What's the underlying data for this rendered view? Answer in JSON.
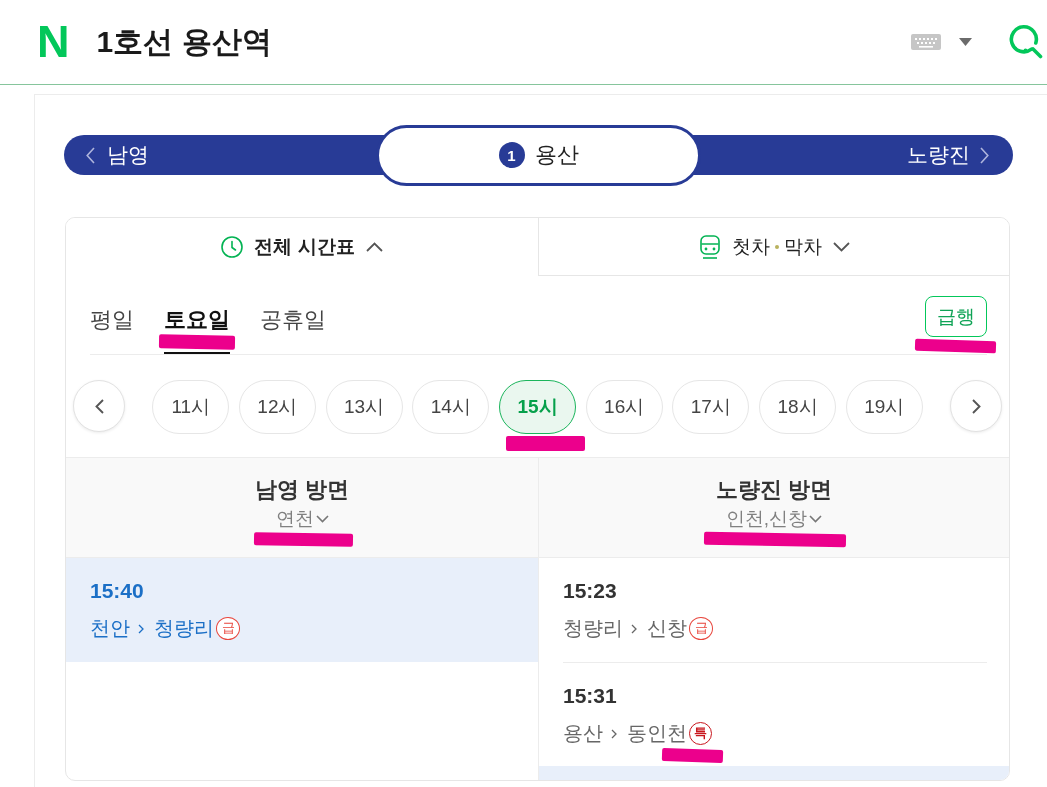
{
  "header": {
    "logo": "N",
    "title": "1호선 용산역"
  },
  "station_nav": {
    "prev": "남영",
    "current": {
      "line": "1",
      "name": "용산"
    },
    "next": "노량진"
  },
  "view_tabs": [
    {
      "kind": "full",
      "label_parts": [
        "전체 시간표"
      ],
      "selected": true,
      "expanded": true
    },
    {
      "kind": "first_last",
      "label_parts": [
        "첫차",
        "막차"
      ],
      "selected": false,
      "expanded": false
    }
  ],
  "day_tabs": [
    {
      "label": "평일",
      "selected": false,
      "marked": false
    },
    {
      "label": "토요일",
      "selected": true,
      "marked": true
    },
    {
      "label": "공휴일",
      "selected": false,
      "marked": false
    }
  ],
  "express_filter": {
    "label": "급행",
    "marked": true
  },
  "hour_chips": [
    {
      "label": "11시",
      "selected": false,
      "marked": false
    },
    {
      "label": "12시",
      "selected": false,
      "marked": false
    },
    {
      "label": "13시",
      "selected": false,
      "marked": false
    },
    {
      "label": "14시",
      "selected": false,
      "marked": false
    },
    {
      "label": "15시",
      "selected": true,
      "marked": true
    },
    {
      "label": "16시",
      "selected": false,
      "marked": false
    },
    {
      "label": "17시",
      "selected": false,
      "marked": false
    },
    {
      "label": "18시",
      "selected": false,
      "marked": false
    },
    {
      "label": "19시",
      "selected": false,
      "marked": false
    }
  ],
  "directions": [
    {
      "name": "남영 방면",
      "terminus": "연천",
      "marked": true,
      "trains": [
        {
          "time": "15:40",
          "from": "천안",
          "to": "청량리",
          "badge": {
            "text": "급",
            "kind": "express",
            "marked": false
          },
          "highlighted": true
        }
      ]
    },
    {
      "name": "노량진 방면",
      "terminus": "인천,신창",
      "marked": true,
      "trains": [
        {
          "time": "15:23",
          "from": "청량리",
          "to": "신창",
          "badge": {
            "text": "급",
            "kind": "express",
            "marked": false
          },
          "highlighted": false
        },
        {
          "time": "15:31",
          "from": "용산",
          "to": "동인천",
          "badge": {
            "text": "특",
            "kind": "special",
            "marked": true
          },
          "highlighted": false
        },
        {
          "highlighted": true
        }
      ]
    }
  ]
}
